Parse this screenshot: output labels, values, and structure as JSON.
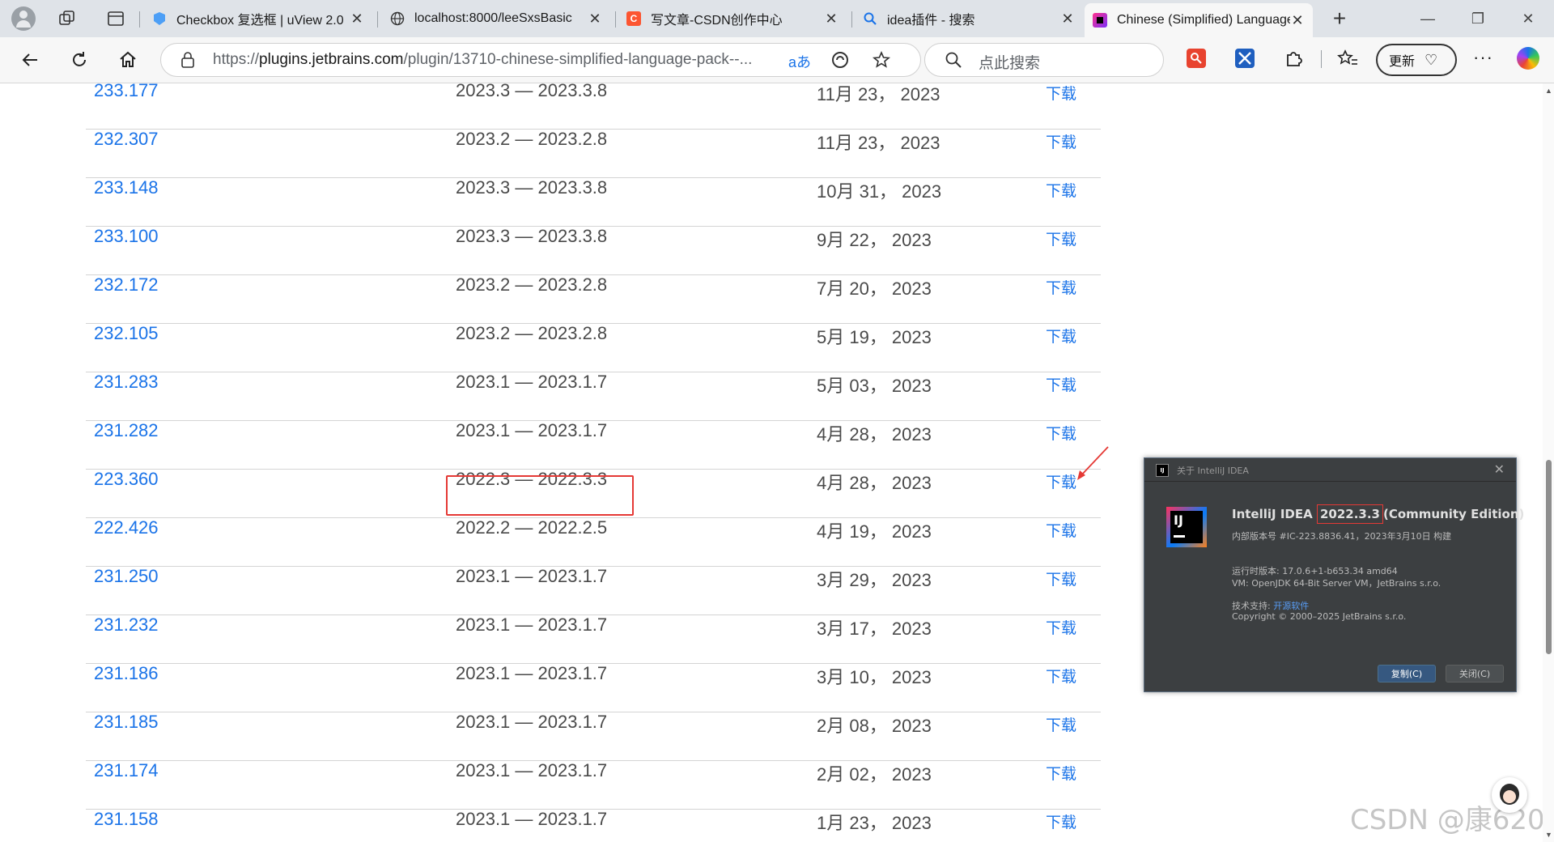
{
  "browser": {
    "tabs": [
      {
        "title": "Checkbox 复选框 | uView 2.0",
        "icon": "uview-icon"
      },
      {
        "title": "localhost:8000/leeSxsBasic",
        "icon": "globe-icon"
      },
      {
        "title": "写文章-CSDN创作中心",
        "icon": "csdn-icon"
      },
      {
        "title": "idea插件 - 搜索",
        "icon": "bing-search-icon"
      },
      {
        "title": "Chinese (Simplified) Language",
        "icon": "jetbrains-icon"
      }
    ],
    "url_prefix": "https://",
    "url_host": "plugins.jetbrains.com",
    "url_path": "/plugin/13710-chinese-simplified-language-pack--...",
    "search_placeholder": "点此搜索",
    "update_label": "更新",
    "new_tab_symbol": "+"
  },
  "table": {
    "download_label": "下载",
    "rows": [
      {
        "version": "233.177",
        "range": "2023.3 — 2023.3.8",
        "date": "11月 23， 2023"
      },
      {
        "version": "232.307",
        "range": "2023.2 — 2023.2.8",
        "date": "11月 23， 2023"
      },
      {
        "version": "233.148",
        "range": "2023.3 — 2023.3.8",
        "date": "10月 31， 2023"
      },
      {
        "version": "233.100",
        "range": "2023.3 — 2023.3.8",
        "date": "9月 22， 2023"
      },
      {
        "version": "232.172",
        "range": "2023.2 — 2023.2.8",
        "date": "7月 20， 2023"
      },
      {
        "version": "232.105",
        "range": "2023.2 — 2023.2.8",
        "date": "5月 19， 2023"
      },
      {
        "version": "231.283",
        "range": "2023.1 — 2023.1.7",
        "date": "5月 03， 2023"
      },
      {
        "version": "231.282",
        "range": "2023.1 — 2023.1.7",
        "date": "4月 28， 2023"
      },
      {
        "version": "223.360",
        "range": "2022.3 — 2022.3.3",
        "date": "4月 28， 2023"
      },
      {
        "version": "222.426",
        "range": "2022.2 — 2022.2.5",
        "date": "4月 19， 2023"
      },
      {
        "version": "231.250",
        "range": "2023.1 — 2023.1.7",
        "date": "3月 29， 2023"
      },
      {
        "version": "231.232",
        "range": "2023.1 — 2023.1.7",
        "date": "3月 17， 2023"
      },
      {
        "version": "231.186",
        "range": "2023.1 — 2023.1.7",
        "date": "3月 10， 2023"
      },
      {
        "version": "231.185",
        "range": "2023.1 — 2023.1.7",
        "date": "2月 08， 2023"
      },
      {
        "version": "231.174",
        "range": "2023.1 — 2023.1.7",
        "date": "2月 02， 2023"
      },
      {
        "version": "231.158",
        "range": "2023.1 — 2023.1.7",
        "date": "1月 23， 2023"
      }
    ]
  },
  "dialog": {
    "title": "关于 IntelliJ IDEA",
    "logo_text": "IJ",
    "product_name": "IntelliJ IDEA",
    "product_version": "2022.3.3",
    "product_edition": "(Community Edition)",
    "build": "内部版本号 #IC-223.8836.41，2023年3月10日 构建",
    "runtime": "运行时版本: 17.0.6+1-b653.34 amd64",
    "vm": "VM: OpenJDK 64-Bit Server VM，JetBrains s.r.o.",
    "support_label": "技术支持:",
    "support_link": "开源软件",
    "copyright": "Copyright © 2000–2025 JetBrains s.r.o.",
    "copy_button": "复制(C)",
    "close_button": "关闭(C)"
  },
  "watermark": "CSDN @康620",
  "colors": {
    "link": "#1a73e8",
    "highlight": "#e53935",
    "dialog_bg": "#3c3f41"
  }
}
